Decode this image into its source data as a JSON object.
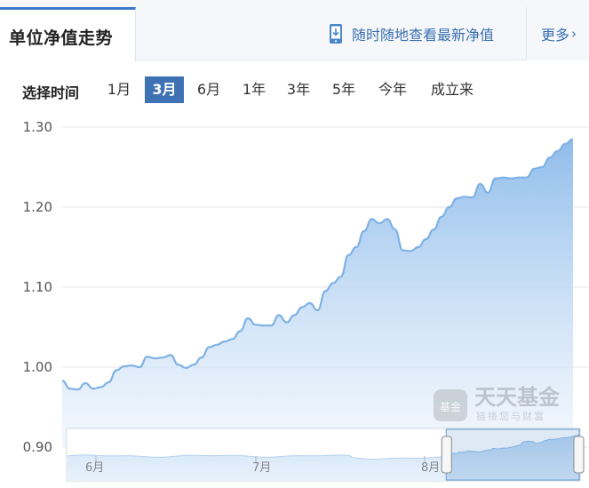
{
  "header": {
    "active_tab": "单位净值走势",
    "mobile_link": "随时随地查看最新净值",
    "more": "更多",
    "more_chevron": "›"
  },
  "range": {
    "label": "选择时间",
    "options": [
      "1月",
      "3月",
      "6月",
      "1年",
      "3年",
      "5年",
      "今年",
      "成立来"
    ],
    "selected": "3月"
  },
  "watermark": {
    "logo_text": "基金",
    "name": "天天基金",
    "slogan": "链接您与财富"
  },
  "colors": {
    "accent": "#3f72b5",
    "series_line": "#7fb2e5",
    "fill_top": "#8ab9ea",
    "fill_bottom": "#eaf3fc",
    "grid": "#e3e6ea"
  },
  "chart_data": {
    "type": "area",
    "y_ticks": [
      "1.30",
      "1.20",
      "1.10",
      "1.00",
      "0.90"
    ],
    "ylim": [
      0.9,
      1.3
    ],
    "grid": true,
    "navigator_labels": [
      "6月",
      "7月",
      "8月"
    ],
    "navigator_window": [
      0.74,
      1.0
    ],
    "x": [
      0,
      1,
      2,
      3,
      4,
      5,
      6,
      7,
      8,
      9,
      10,
      11,
      12,
      13,
      14,
      15,
      16,
      17,
      18,
      19,
      20,
      21,
      22,
      23,
      24,
      25,
      26,
      27,
      28,
      29,
      30,
      31,
      32,
      33,
      34,
      35,
      36,
      37,
      38,
      39,
      40,
      41,
      42,
      43,
      44,
      45,
      46,
      47,
      48,
      49,
      50,
      51,
      52,
      53,
      54,
      55,
      56,
      57,
      58,
      59,
      60,
      61,
      62,
      63,
      64,
      65,
      66
    ],
    "values": [
      0.983,
      0.973,
      0.972,
      0.98,
      0.973,
      0.975,
      0.981,
      0.996,
      1.001,
      1.002,
      1.0,
      1.013,
      1.011,
      1.012,
      1.015,
      1.003,
      0.999,
      1.003,
      1.012,
      1.025,
      1.028,
      1.032,
      1.035,
      1.045,
      1.061,
      1.053,
      1.052,
      1.052,
      1.065,
      1.056,
      1.065,
      1.075,
      1.08,
      1.071,
      1.095,
      1.105,
      1.113,
      1.14,
      1.15,
      1.17,
      1.185,
      1.18,
      1.185,
      1.172,
      1.146,
      1.145,
      1.15,
      1.16,
      1.172,
      1.188,
      1.2,
      1.211,
      1.213,
      1.212,
      1.229,
      1.218,
      1.236,
      1.237,
      1.236,
      1.237,
      1.237,
      1.248,
      1.25,
      1.262,
      1.27,
      1.279,
      1.285
    ]
  }
}
